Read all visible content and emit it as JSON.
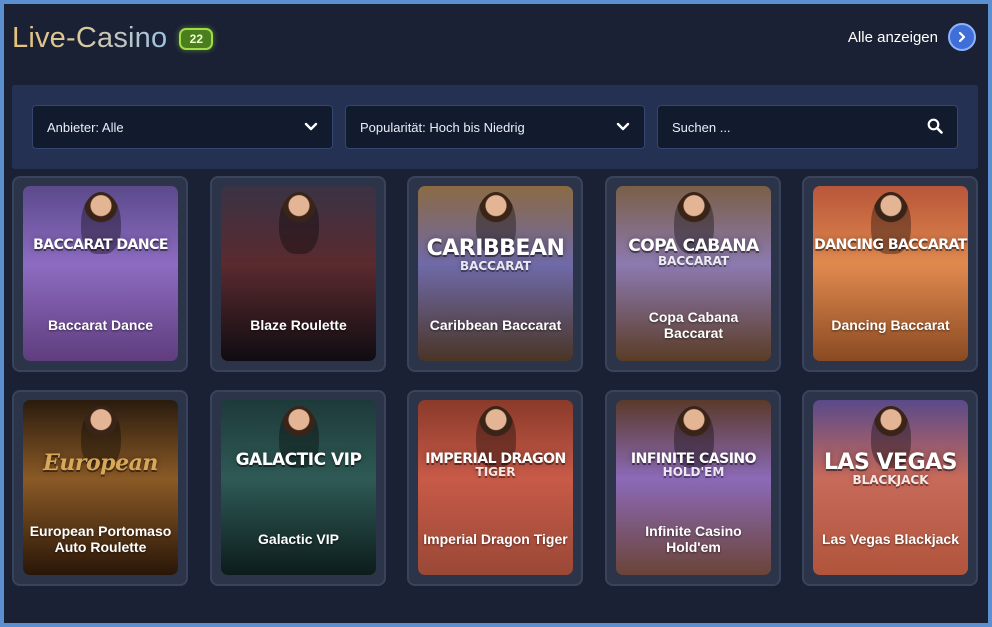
{
  "header": {
    "title": "Live-Casino",
    "count": "22",
    "show_all_label": "Alle anzeigen"
  },
  "filters": {
    "provider_label": "Anbieter: Alle",
    "sort_label": "Popularität: Hoch bis Niedrig",
    "search_placeholder": "Suchen ..."
  },
  "games": [
    {
      "name": "Baccarat Dance",
      "brand": "BACCARAT DANCE",
      "brand_sub": "",
      "bg_top": "#5b4a8c",
      "bg_mid": "#8d6cc1",
      "bg_bottom": "#5f3d7e"
    },
    {
      "name": "Blaze Roulette",
      "brand": "",
      "brand_sub": "",
      "bg_top": "#3a3345",
      "bg_mid": "#5a2a2e",
      "bg_bottom": "#0f0c12"
    },
    {
      "name": "Caribbean Baccarat",
      "brand": "CARIBBEAN",
      "brand_sub": "BACCARAT",
      "bg_top": "#8b6a44",
      "bg_mid": "#6f6aa8",
      "bg_bottom": "#4a3526"
    },
    {
      "name": "Copa Cabana Baccarat",
      "brand": "COPA CABANA",
      "brand_sub": "BACCARAT",
      "bg_top": "#7a5f48",
      "bg_mid": "#8c7ab0",
      "bg_bottom": "#5a3c26"
    },
    {
      "name": "Dancing Baccarat",
      "brand": "DANCING BACCARAT",
      "brand_sub": "",
      "bg_top": "#b8563a",
      "bg_mid": "#e0894f",
      "bg_bottom": "#8a4a22"
    },
    {
      "name": "European Portomaso Auto Roulette",
      "brand": "European",
      "brand_sub": "",
      "bg_top": "#2a1b0e",
      "bg_mid": "#8a5a26",
      "bg_bottom": "#2a1608"
    },
    {
      "name": "Galactic VIP",
      "brand": "GALACTIC VIP",
      "brand_sub": "",
      "bg_top": "#1d3a3a",
      "bg_mid": "#2f5a55",
      "bg_bottom": "#0c1c1c"
    },
    {
      "name": "Imperial Dragon Tiger",
      "brand": "IMPERIAL DRAGON",
      "brand_sub": "TIGER",
      "bg_top": "#8a3a2a",
      "bg_mid": "#c85a48",
      "bg_bottom": "#9a4836"
    },
    {
      "name": "Infinite Casino Hold'em",
      "brand": "INFINITE CASINO",
      "brand_sub": "HOLD'EM",
      "bg_top": "#5a3a2a",
      "bg_mid": "#8c6ab8",
      "bg_bottom": "#6a4438"
    },
    {
      "name": "Las Vegas Blackjack",
      "brand": "LAS VEGAS",
      "brand_sub": "BLACKJACK",
      "bg_top": "#5a4a8a",
      "bg_mid": "#c86a5a",
      "bg_bottom": "#b0543c"
    }
  ]
}
